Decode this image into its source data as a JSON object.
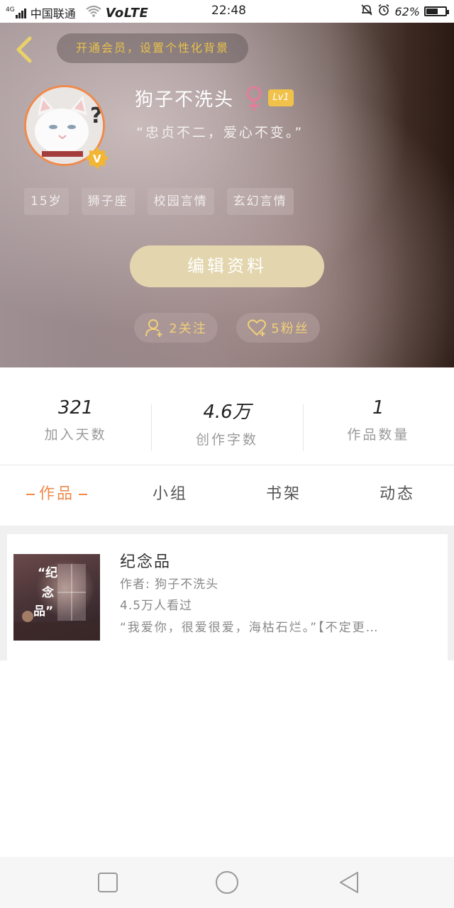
{
  "status_bar": {
    "network": "4G",
    "carrier": "中国联通",
    "volte": "VoLTE",
    "time": "22:48",
    "battery_percent": "62%",
    "battery_level": 0.62
  },
  "header": {
    "vip_banner": "开通会员，设置个性化背景",
    "nickname": "狗子不洗头",
    "level": "Lv1",
    "signature": "“忠贞不二，爱心不变。”",
    "tags": [
      "15岁",
      "狮子座",
      "校园言情",
      "玄幻言情"
    ],
    "edit_button": "编辑资料",
    "follow_label": "2关注",
    "fans_label": "5粉丝",
    "accent_gold": "#e9c24a",
    "gender_color": "#e67b9a"
  },
  "stats": [
    {
      "value": "321",
      "label": "加入天数"
    },
    {
      "value": "4.6万",
      "label": "创作字数"
    },
    {
      "value": "1",
      "label": "作品数量"
    }
  ],
  "tabs": [
    {
      "label": "作品",
      "active": true
    },
    {
      "label": "小组",
      "active": false
    },
    {
      "label": "书架",
      "active": false
    },
    {
      "label": "动态",
      "active": false
    }
  ],
  "works": [
    {
      "title": "纪念品",
      "author": "作者: 狗子不洗头",
      "views": "4.5万人看过",
      "description": "“我爱你，很爱很爱，海枯石烂。”【不定更…",
      "cover_text": [
        "“纪",
        "念",
        "品”"
      ]
    }
  ],
  "nav_bar": {
    "icons": [
      "square-icon",
      "circle-icon",
      "triangle-back-icon"
    ]
  },
  "colors": {
    "active_tab": "#f08a4b",
    "edit_button_bg": "#e3d6ae"
  }
}
